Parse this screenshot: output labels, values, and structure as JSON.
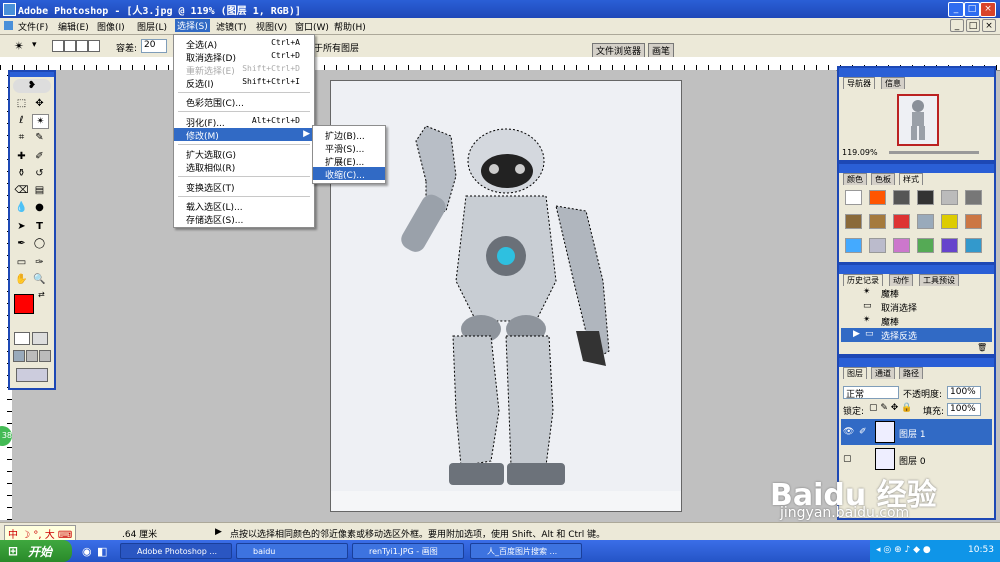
{
  "window": {
    "title": "Adobe Photoshop - [人3.jpg @ 119% (图层 1, RGB)]"
  },
  "menubar": {
    "items": [
      "文件(F)",
      "编辑(E)",
      "图像(I)",
      "图层(L)",
      "选择(S)",
      "滤镜(T)",
      "视图(V)",
      "窗口(W)",
      "帮助(H)"
    ]
  },
  "options": {
    "tolerance_label": "容差:",
    "tolerance_value": "20",
    "all_layers_label": "于所有图层",
    "file_browser_tab": "文件浏览器",
    "brushes_tab": "画笔"
  },
  "select_menu": {
    "items": [
      {
        "label": "全选(A)",
        "shortcut": "Ctrl+A",
        "disabled": false
      },
      {
        "label": "取消选择(D)",
        "shortcut": "Ctrl+D",
        "disabled": false
      },
      {
        "label": "重新选择(E)",
        "shortcut": "Shift+Ctrl+D",
        "disabled": true
      },
      {
        "label": "反选(I)",
        "shortcut": "Shift+Ctrl+I",
        "disabled": false
      },
      {
        "label": "色彩范围(C)...",
        "shortcut": "",
        "disabled": false
      },
      {
        "label": "羽化(F)...",
        "shortcut": "Alt+Ctrl+D",
        "disabled": false
      },
      {
        "label": "修改(M)",
        "shortcut": "",
        "disabled": false
      },
      {
        "label": "扩大选取(G)",
        "shortcut": "",
        "disabled": false
      },
      {
        "label": "选取相似(R)",
        "shortcut": "",
        "disabled": false
      },
      {
        "label": "变换选区(T)",
        "shortcut": "",
        "disabled": false
      },
      {
        "label": "载入选区(L)...",
        "shortcut": "",
        "disabled": false
      },
      {
        "label": "存储选区(S)...",
        "shortcut": "",
        "disabled": false
      }
    ]
  },
  "modify_submenu": {
    "items": [
      "扩边(B)...",
      "平滑(S)...",
      "扩展(E)...",
      "收缩(C)..."
    ],
    "highlighted": "收缩(C)..."
  },
  "navigator": {
    "tabs": [
      "导航器",
      "信息"
    ],
    "zoom": "119.09%"
  },
  "color_panel": {
    "tabs": [
      "颜色",
      "色板",
      "样式"
    ]
  },
  "history": {
    "tabs": [
      "历史记录",
      "动作",
      "工具预设"
    ],
    "items": [
      "魔棒",
      "取消选择",
      "魔棒",
      "选择反选"
    ]
  },
  "layers": {
    "tabs": [
      "图层",
      "通道",
      "路径"
    ],
    "blend_mode": "正常",
    "opacity_label": "不透明度:",
    "opacity": "100%",
    "lock_label": "锁定:",
    "fill_label": "填充:",
    "fill": "100%",
    "items": [
      "图层 1",
      "图层 0"
    ]
  },
  "statusbar": {
    "ime": "中",
    "ime_extra": "大",
    "doc_size": ".64 厘米",
    "hint": "点按以选择相同颜色的邻近像素或移动选区外框。要用附加选项，使用 Shift、Alt 和 Ctrl 键。"
  },
  "taskbar": {
    "start": "开始",
    "tasks": [
      "Adobe Photoshop ...",
      "baidu",
      "renTyi1.JPG - 画图",
      "人_百度图片搜索 ..."
    ],
    "time": "10:53"
  },
  "watermark": {
    "site": "jingyan.baidu.com"
  },
  "colors": {
    "foreground": "#ff0000",
    "background": "#000000",
    "menu_highlight": "#316ac5",
    "titlebar": "#2a5fd6"
  },
  "circle_badge": "38"
}
